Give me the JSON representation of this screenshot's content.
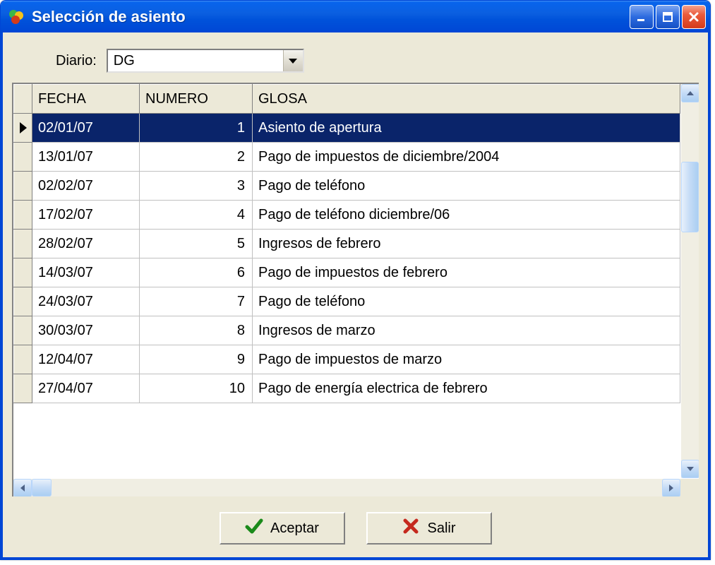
{
  "window": {
    "title": "Selección de asiento"
  },
  "selector": {
    "label": "Diario:",
    "value": "DG"
  },
  "table": {
    "columns": [
      "FECHA",
      "NUMERO",
      "GLOSA"
    ],
    "selected_index": 0,
    "rows": [
      {
        "fecha": "02/01/07",
        "numero": 1,
        "glosa": "Asiento de apertura"
      },
      {
        "fecha": "13/01/07",
        "numero": 2,
        "glosa": "Pago de impuestos de diciembre/2004"
      },
      {
        "fecha": "02/02/07",
        "numero": 3,
        "glosa": "Pago de teléfono"
      },
      {
        "fecha": "17/02/07",
        "numero": 4,
        "glosa": "Pago de teléfono diciembre/06"
      },
      {
        "fecha": "28/02/07",
        "numero": 5,
        "glosa": "Ingresos de febrero"
      },
      {
        "fecha": "14/03/07",
        "numero": 6,
        "glosa": "Pago de impuestos de febrero"
      },
      {
        "fecha": "24/03/07",
        "numero": 7,
        "glosa": "Pago de teléfono"
      },
      {
        "fecha": "30/03/07",
        "numero": 8,
        "glosa": "Ingresos de marzo"
      },
      {
        "fecha": "12/04/07",
        "numero": 9,
        "glosa": "Pago de impuestos de marzo"
      },
      {
        "fecha": "27/04/07",
        "numero": 10,
        "glosa": "Pago de energía electrica de febrero"
      }
    ]
  },
  "buttons": {
    "accept": "Aceptar",
    "exit": "Salir"
  },
  "icons": {
    "app": "app-icon",
    "minimize": "minimize-icon",
    "maximize": "maximize-icon",
    "close": "close-icon",
    "check": "check-icon",
    "x": "x-icon"
  }
}
